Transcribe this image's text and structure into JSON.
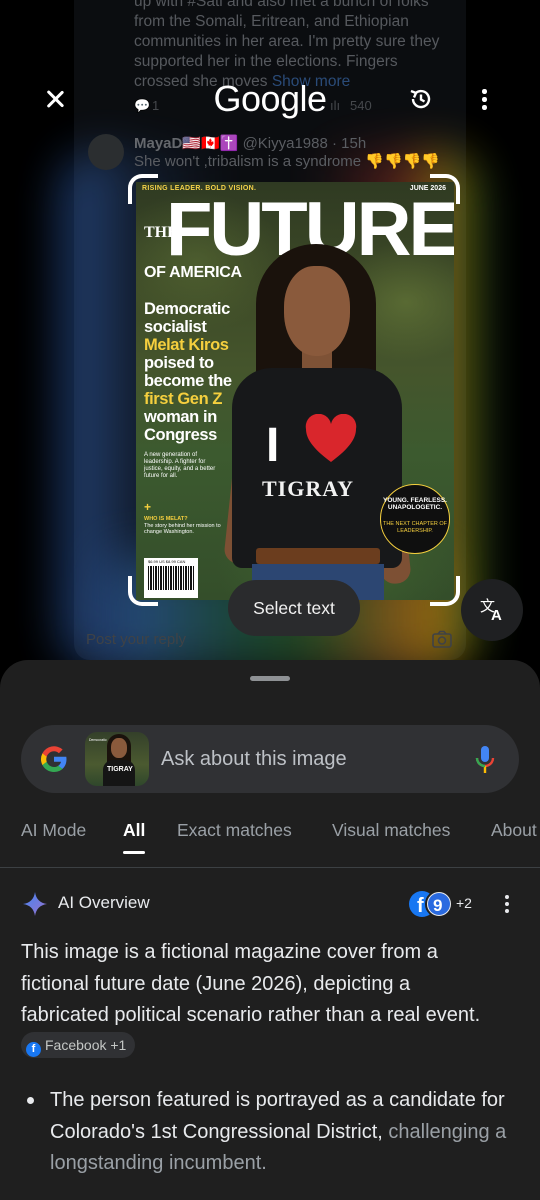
{
  "background_post": {
    "text_line1": "up with #Sati and also met a bunch of folks",
    "text_line2": "from the Somali, Eritrean, and Ethiopian",
    "text_line3": "communities in her area. I'm pretty sure they",
    "text_line4": "supported her in the elections. Fingers",
    "text_line5": "crossed she moves ",
    "show_more": "Show more",
    "replies": "1",
    "views": "540",
    "reply_name": "MayaD🇺🇸🇨🇦✝️",
    "reply_handle": "@Kiyya1988 · 15h",
    "reply_text": "She won't ,tribalism is a syndrome 👎👎👎👎",
    "post_reply_placeholder": "Post your reply"
  },
  "header": {
    "title": "Google"
  },
  "magazine": {
    "topline": "RISING LEADER. BOLD VISION.",
    "date": "JUNE 2026",
    "the": "THE",
    "title": "FUTURE",
    "subtitle": "OF AMERICA",
    "headline_1": "Democratic",
    "headline_2": "socialist",
    "headline_name": "Melat Kiros",
    "headline_3": "poised to",
    "headline_4": "become the",
    "headline_5": "first Gen Z",
    "headline_6": "woman in",
    "headline_7": "Congress",
    "small_text": "A new generation of leadership. A fighter for justice, equity, and a better future for all.",
    "plus": "+",
    "who_title": "WHO IS MELAT?",
    "who_text": "The story behind her mission to change Washington.",
    "price": "$6.99 US  $8.99 CAN",
    "shirt_i": "I",
    "shirt_word": "TIGRAY",
    "badge_top": "YOUNG. FEARLESS. UNAPOLOGETIC.",
    "badge_bottom": "THE NEXT CHAPTER OF LEADERSHIP."
  },
  "lens": {
    "select_text": "Select text",
    "translate_icon": "translate-icon"
  },
  "search": {
    "placeholder": "Ask about this image"
  },
  "tabs": [
    {
      "label": "AI Mode"
    },
    {
      "label": "All"
    },
    {
      "label": "Exact matches"
    },
    {
      "label": "Visual matches"
    },
    {
      "label": "About"
    }
  ],
  "active_tab": "All",
  "ai_overview": {
    "title": "AI Overview",
    "sources_extra": "+2",
    "paragraph": "This image is a fictional magazine cover from a fictional future date (June 2026), depicting a fabricated political scenario rather than a real event.",
    "chip_label": "Facebook +1",
    "bullet_1_main": "The person featured is portrayed as a candidate for Colorado's 1st Congressional District,",
    "bullet_1_fade": "challenging a longstanding incumbent."
  },
  "colors": {
    "google_blue": "#4285F4",
    "google_red": "#EA4335",
    "google_yellow": "#FBBC05",
    "google_green": "#34A853",
    "sheet_bg": "#1F1F1F",
    "magazine_accent": "#F5CF3E"
  }
}
